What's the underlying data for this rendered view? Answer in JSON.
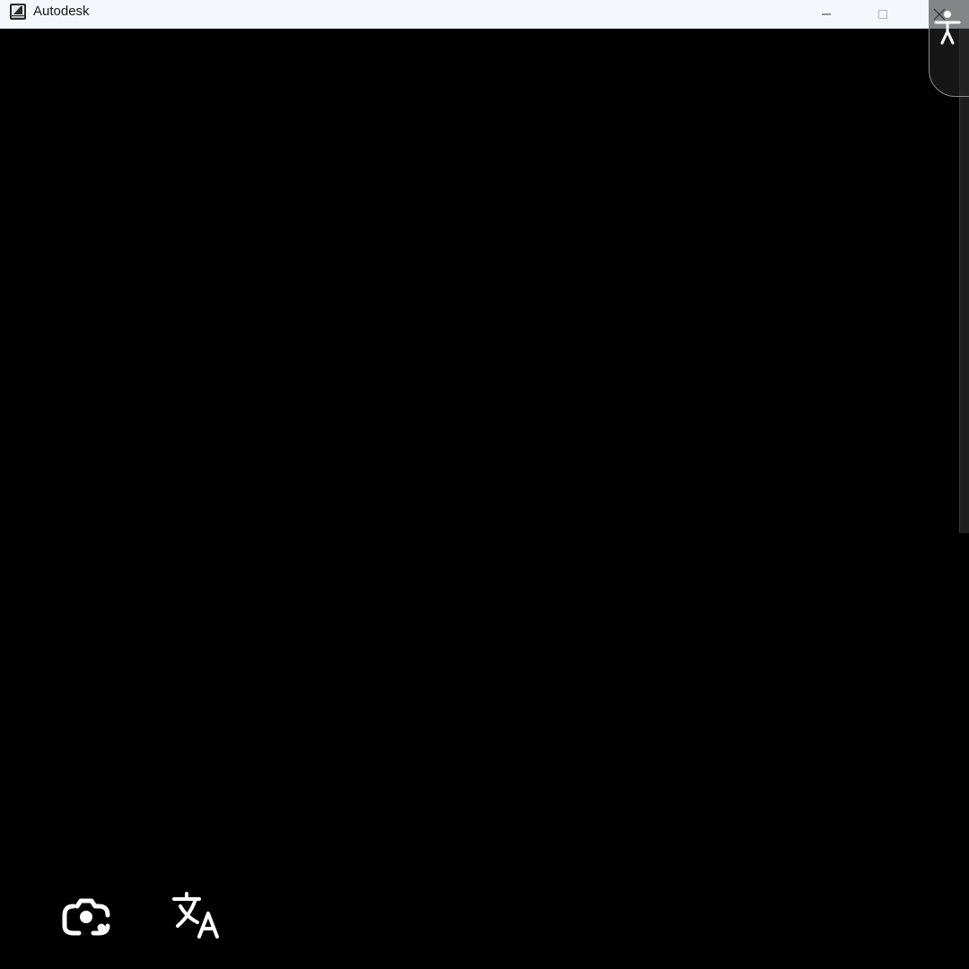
{
  "window": {
    "title": "Autodesk",
    "app_icon": "autodesk-logo-icon"
  },
  "controls": {
    "minimize_icon": "minimize-icon",
    "maximize_icon": "maximize-icon",
    "close_icon": "close-icon"
  },
  "overlay": {
    "accessibility_icon": "accessibility-person-icon",
    "lens_icon": "google-lens-icon",
    "translate_icon": "translate-icon"
  },
  "colors": {
    "titlebar": "#f4f7fb",
    "content": "#000000",
    "icon": "#ffffff"
  }
}
